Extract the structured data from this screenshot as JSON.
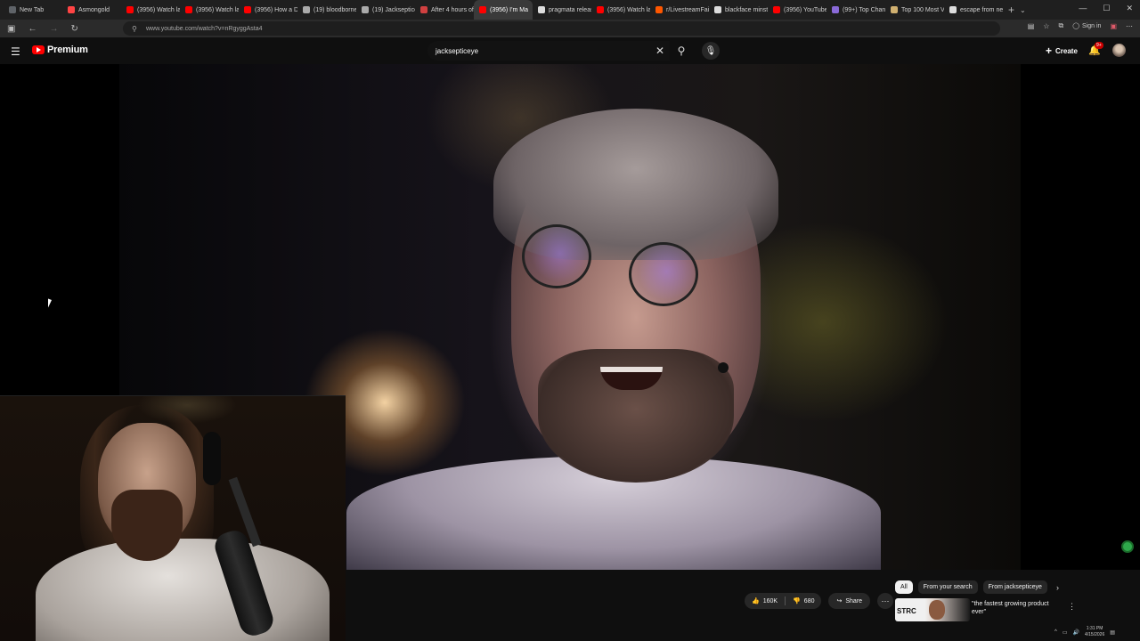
{
  "browser": {
    "tabs": [
      {
        "label": "New Tab",
        "color": "#5f6368"
      },
      {
        "label": "Asmongold",
        "color": "#ff4444"
      },
      {
        "label": "(3956) Watch lat",
        "color": "#ff0000"
      },
      {
        "label": "(3956) Watch lat",
        "color": "#ff0000"
      },
      {
        "label": "(3956) How a D",
        "color": "#ff0000"
      },
      {
        "label": "(19) bloodborne",
        "color": "#aaaaaa"
      },
      {
        "label": "(19) Jacksepticey",
        "color": "#aaaaaa"
      },
      {
        "label": "After 4 hours of",
        "color": "#d04040"
      },
      {
        "label": "(3956) I'm Ma",
        "color": "#ff0000"
      },
      {
        "label": "pragmata releas",
        "color": "#dddddd"
      },
      {
        "label": "(3956) Watch lat",
        "color": "#ff0000"
      },
      {
        "label": "r/LivestreamFail",
        "color": "#ff5700"
      },
      {
        "label": "blackface minstr",
        "color": "#dddddd"
      },
      {
        "label": "(3956) YouTube",
        "color": "#ff0000"
      },
      {
        "label": "(99+) Top Chann",
        "color": "#8a6ad8"
      },
      {
        "label": "Top 100 Most Vi",
        "color": "#d0b070"
      },
      {
        "label": "escape from nev",
        "color": "#dddddd"
      }
    ],
    "active_tab_index": 8,
    "url": "www.youtube.com/watch?v=nRgyggAsta4",
    "sign_in_label": "Sign in"
  },
  "youtube": {
    "logo_text": "Premium",
    "search_value": "jacksepticeye",
    "create_label": "Create",
    "notification_badge": "9+",
    "actions": {
      "likes": "160K",
      "dislikes": "680",
      "share_label": "Share"
    },
    "chips": [
      "All",
      "From your search",
      "From jacksepticeye"
    ],
    "recommendation": {
      "thumb_text": "STRC",
      "title": "\"the fastest growing product ever\""
    }
  },
  "taskbar": {
    "time": "1:31 PM",
    "date": "4/15/2026"
  }
}
